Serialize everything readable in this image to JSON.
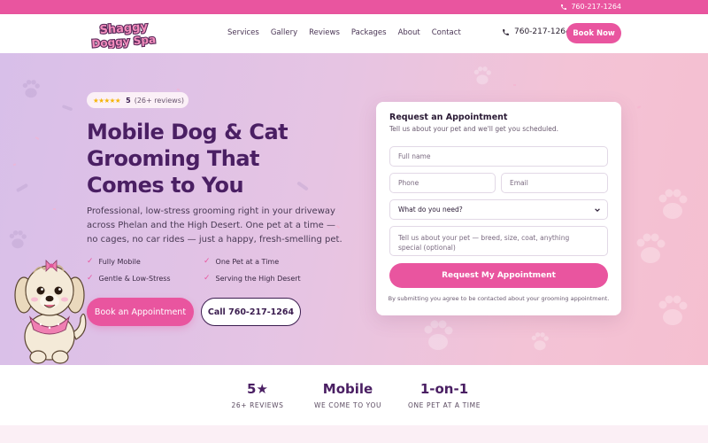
{
  "topbar": {
    "phone": "760-217-1264"
  },
  "nav": {
    "logo_line1": "Shaggy",
    "logo_line2": "Doggy Spa",
    "links": [
      {
        "label": "Services"
      },
      {
        "label": "Gallery"
      },
      {
        "label": "Reviews"
      },
      {
        "label": "Packages"
      },
      {
        "label": "About"
      },
      {
        "label": "Contact"
      }
    ],
    "phone": "760-217-1264",
    "book_now": "Book Now"
  },
  "hero": {
    "rating": {
      "stars": "★★★★★",
      "value": "5",
      "count": "(26+ reviews)"
    },
    "title": "Mobile Dog & Cat Grooming That Comes to You",
    "description": "Professional, low-stress grooming right in your driveway across Phelan and the High Desert. One pet at a time — no cages, no car rides — just a happy, fresh-smelling pet.",
    "features": [
      {
        "label": "Fully Mobile"
      },
      {
        "label": "One Pet at a Time"
      },
      {
        "label": "Gentle & Low-Stress"
      },
      {
        "label": "Serving the High Desert"
      }
    ],
    "book_button": "Book an Appointment",
    "call_button": "Call 760-217-1264"
  },
  "form": {
    "title": "Request an Appointment",
    "subtitle": "Tell us about your pet and we'll get you scheduled.",
    "name_placeholder": "Full name",
    "phone_placeholder": "Phone",
    "email_placeholder": "Email",
    "service_selected": "What do you need?",
    "message_placeholder": "Tell us about your pet — breed, size, coat, anything special (optional)",
    "submit": "Request My Appointment",
    "disclaimer": "By submitting you agree to be contacted about your grooming appointment."
  },
  "stats": [
    {
      "value": "5★",
      "label": "26+ REVIEWS"
    },
    {
      "value": "Mobile",
      "label": "WE COME TO YOU"
    },
    {
      "value": "1-on-1",
      "label": "ONE PET AT A TIME"
    }
  ],
  "colors": {
    "brand_pink": "#e9559f",
    "brand_purple": "#4a1f63",
    "star": "#f5b50a"
  },
  "icons": {
    "phone": "phone-icon",
    "check": "check-icon",
    "chevron": "chevron-down-icon"
  }
}
